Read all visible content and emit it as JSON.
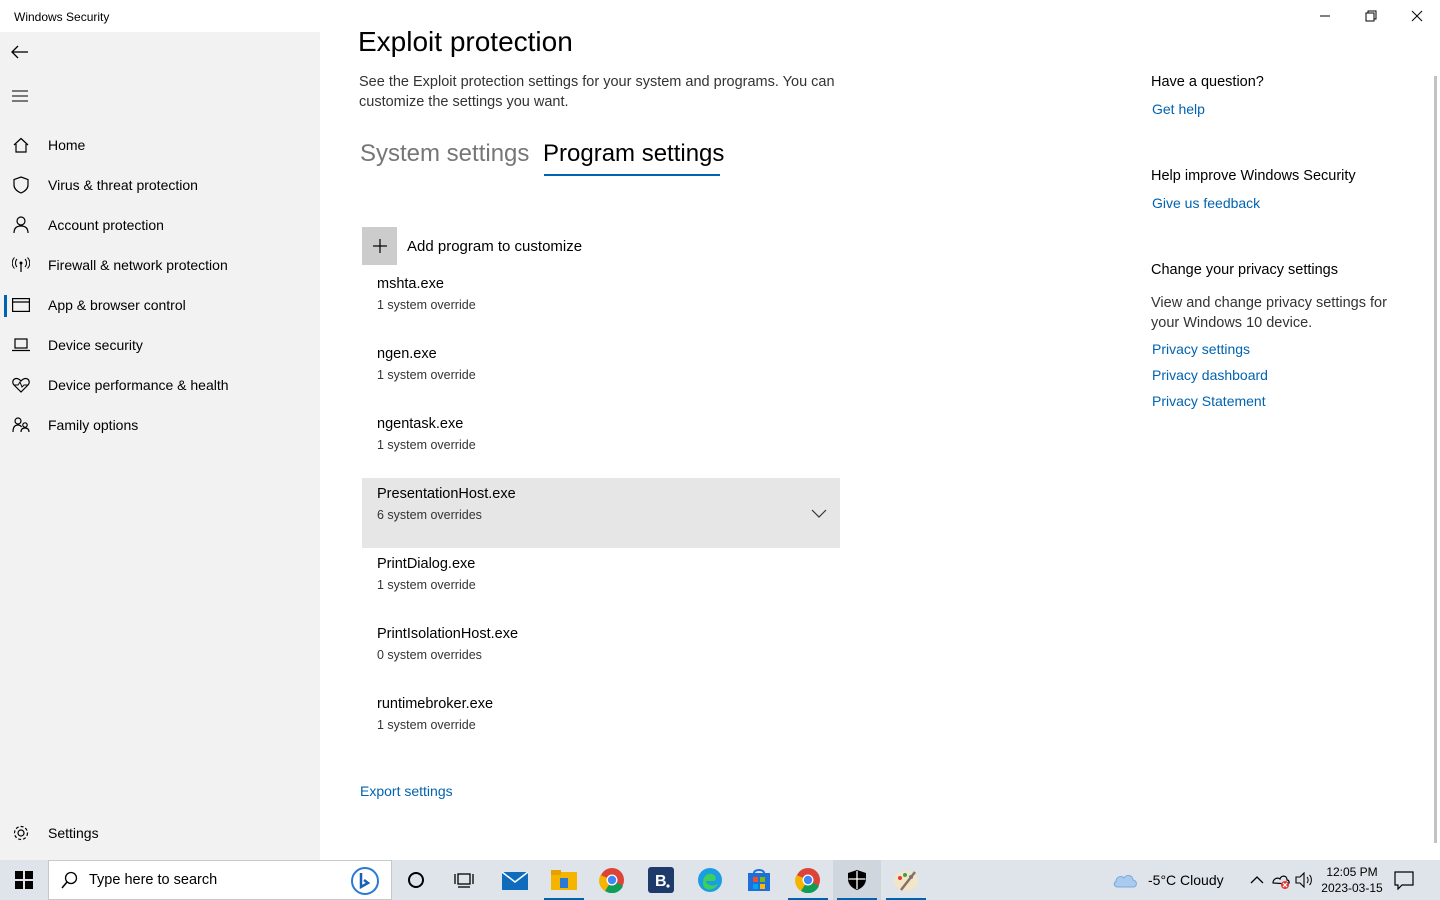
{
  "window": {
    "title": "Windows Security"
  },
  "sidebar": {
    "items": [
      {
        "label": "Home",
        "icon": "home-icon"
      },
      {
        "label": "Virus & threat protection",
        "icon": "shield-icon"
      },
      {
        "label": "Account protection",
        "icon": "person-icon"
      },
      {
        "label": "Firewall & network protection",
        "icon": "antenna-icon"
      },
      {
        "label": "App & browser control",
        "icon": "browser-window-icon",
        "active": true
      },
      {
        "label": "Device security",
        "icon": "laptop-icon"
      },
      {
        "label": "Device performance & health",
        "icon": "heart-icon"
      },
      {
        "label": "Family options",
        "icon": "family-icon"
      }
    ],
    "settings_label": "Settings"
  },
  "main": {
    "title": "Exploit protection",
    "description": "See the Exploit protection settings for your system and programs.  You can customize the settings you want.",
    "tabs": [
      {
        "label": "System settings",
        "selected": false
      },
      {
        "label": "Program settings",
        "selected": true
      }
    ],
    "add_program_label": "Add program to customize",
    "programs": [
      {
        "name": "mshta.exe",
        "overrides": "1 system override"
      },
      {
        "name": "ngen.exe",
        "overrides": "1 system override"
      },
      {
        "name": "ngentask.exe",
        "overrides": "1 system override"
      },
      {
        "name": "PresentationHost.exe",
        "overrides": "6 system overrides",
        "highlighted": true
      },
      {
        "name": "PrintDialog.exe",
        "overrides": "1 system override"
      },
      {
        "name": "PrintIsolationHost.exe",
        "overrides": "0 system overrides"
      },
      {
        "name": "runtimebroker.exe",
        "overrides": "1 system override"
      }
    ],
    "export_label": "Export settings"
  },
  "right_panel": {
    "question_heading": "Have a question?",
    "get_help": "Get help",
    "improve_heading": "Help improve Windows Security",
    "feedback": "Give us feedback",
    "privacy_heading": "Change your privacy settings",
    "privacy_text": "View and change privacy settings for your Windows 10 device.",
    "privacy_links": [
      "Privacy settings",
      "Privacy dashboard",
      "Privacy Statement"
    ]
  },
  "taskbar": {
    "search_placeholder": "Type here to search",
    "apps": [
      "cortana-icon",
      "task-view-icon",
      "mail-icon",
      "file-explorer-icon",
      "chrome-icon",
      "b-app-icon",
      "edge-icon",
      "store-icon",
      "chrome-icon",
      "windows-security-icon",
      "paint-icon"
    ],
    "weather": "-5°C  Cloudy",
    "time": "12:05 PM",
    "date": "2023-03-15"
  },
  "colors": {
    "accent": "#0063b1",
    "sidebar_bg": "#f2f2f2",
    "taskbar_bg": "#dfe4ea",
    "highlight_row": "#e6e6e6"
  }
}
